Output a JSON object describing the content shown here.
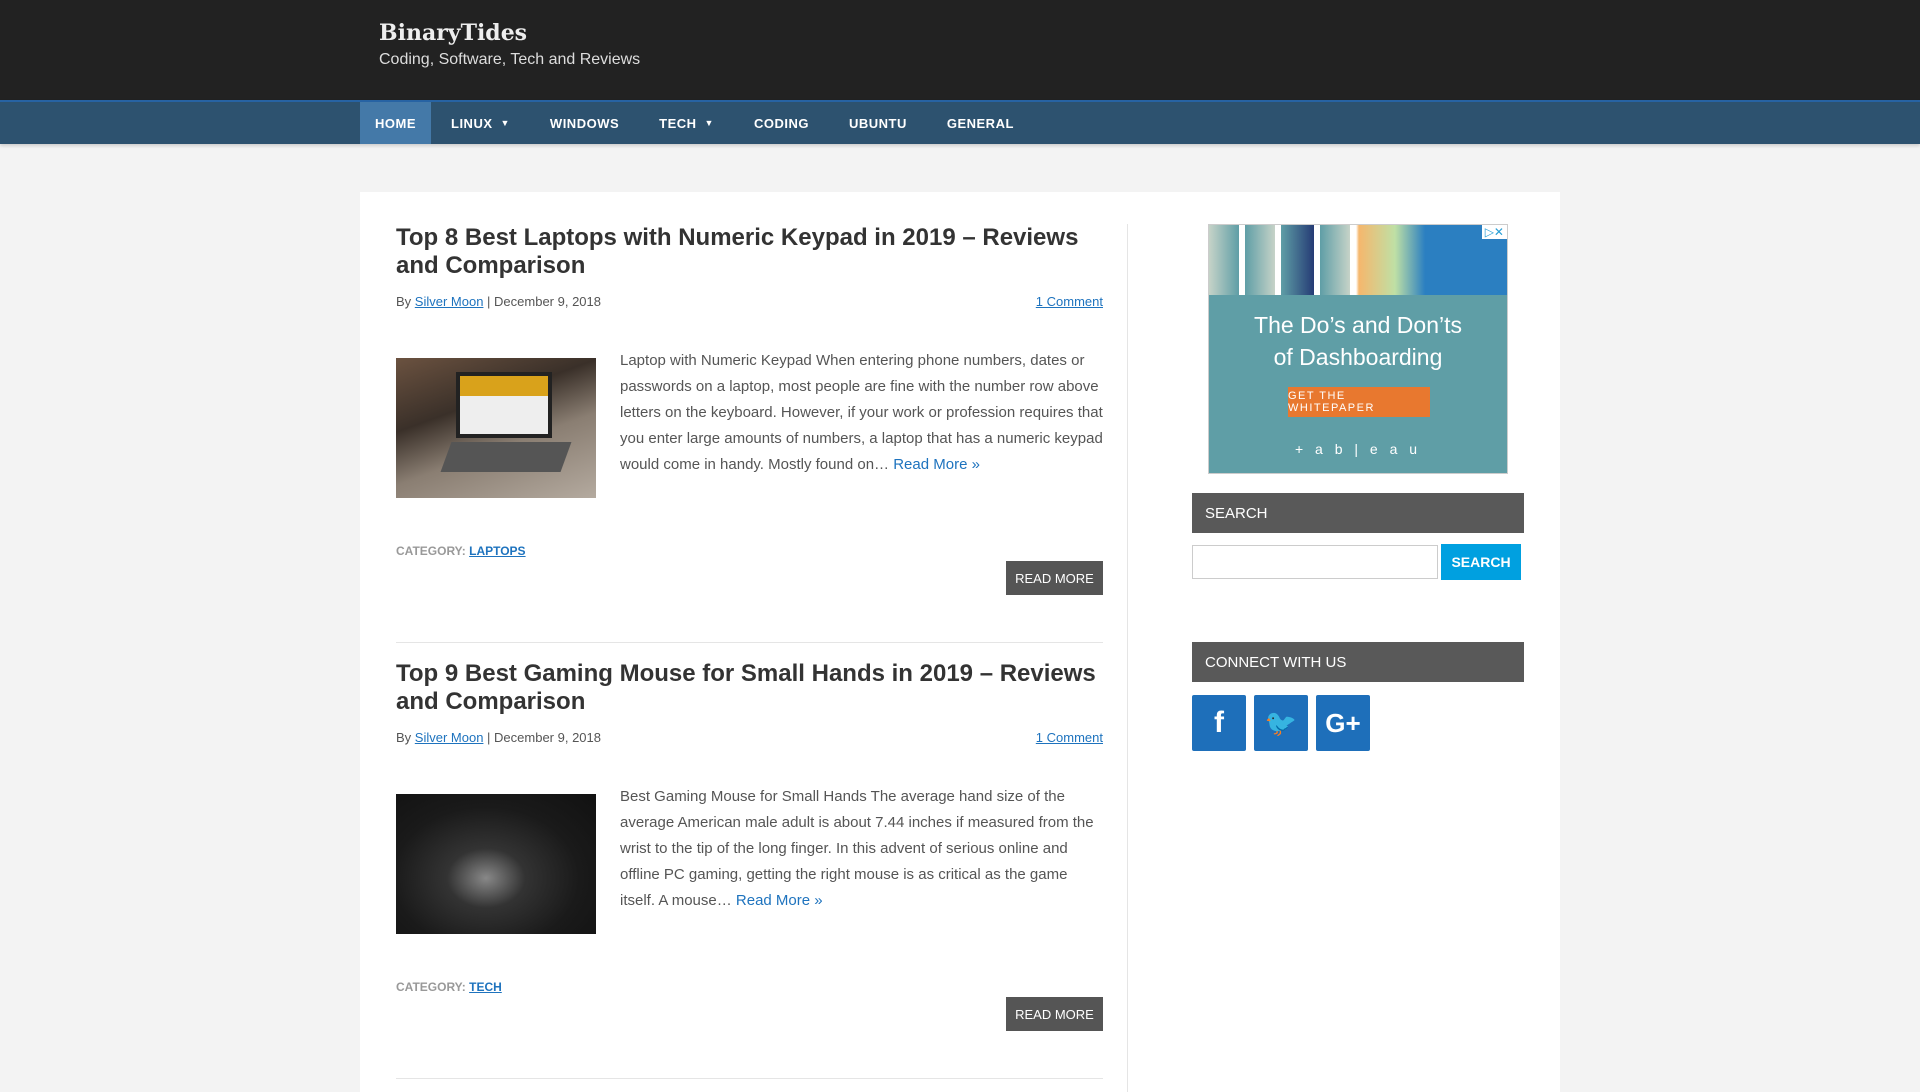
{
  "site": {
    "title": "BinaryTides",
    "tagline": "Coding, Software, Tech and Reviews"
  },
  "nav": [
    {
      "label": "HOME"
    },
    {
      "label": "LINUX"
    },
    {
      "label": "WINDOWS"
    },
    {
      "label": "TECH"
    },
    {
      "label": "CODING"
    },
    {
      "label": "UBUNTU"
    },
    {
      "label": "GENERAL"
    }
  ],
  "posts": [
    {
      "title": "Top 8 Best Laptops with Numeric Keypad in 2019 – Reviews and Comparison",
      "by": "By ",
      "author": "Silver Moon",
      "date": " | December 9, 2018",
      "comments": "1 Comment",
      "excerpt": "Laptop with Numeric Keypad When entering phone numbers, dates or passwords on a laptop, most people are fine with the number row above letters on the keyboard. However, if your work or profession requires that you enter large amounts of numbers, a laptop that has a numeric keypad would come in handy. Mostly found on… ",
      "read_more_link": "Read More »",
      "category_label": "CATEGORY: ",
      "category": "LAPTOPS",
      "read_more_button": "READ MORE"
    },
    {
      "title": "Top 9 Best Gaming Mouse for Small Hands in 2019 – Reviews and Comparison",
      "by": "By ",
      "author": "Silver Moon",
      "date": " | December 9, 2018",
      "comments": "1 Comment",
      "excerpt": "Best Gaming Mouse for Small Hands The average hand size of the average American male adult is about 7.44 inches if measured from the wrist to the tip of the long finger. In this advent of serious online and offline PC gaming, getting the right mouse is as critical as the game itself. A mouse… ",
      "read_more_link": "Read More »",
      "category_label": "CATEGORY: ",
      "category": "TECH",
      "read_more_button": "READ MORE"
    }
  ],
  "ad": {
    "headline1": "The Do’s and Don’ts",
    "headline2": "of Dashboarding",
    "button": "GET THE WHITEPAPER",
    "brand": "+ a b | e a u"
  },
  "sidebar": {
    "search_heading": "SEARCH",
    "search_button": "SEARCH",
    "search_value": "",
    "connect_heading": "CONNECT WITH US",
    "social": [
      {
        "icon": "facebook-icon",
        "glyph": "f"
      },
      {
        "icon": "twitter-icon",
        "glyph": "🐦"
      },
      {
        "icon": "google-plus-icon",
        "glyph": "G+"
      }
    ]
  }
}
